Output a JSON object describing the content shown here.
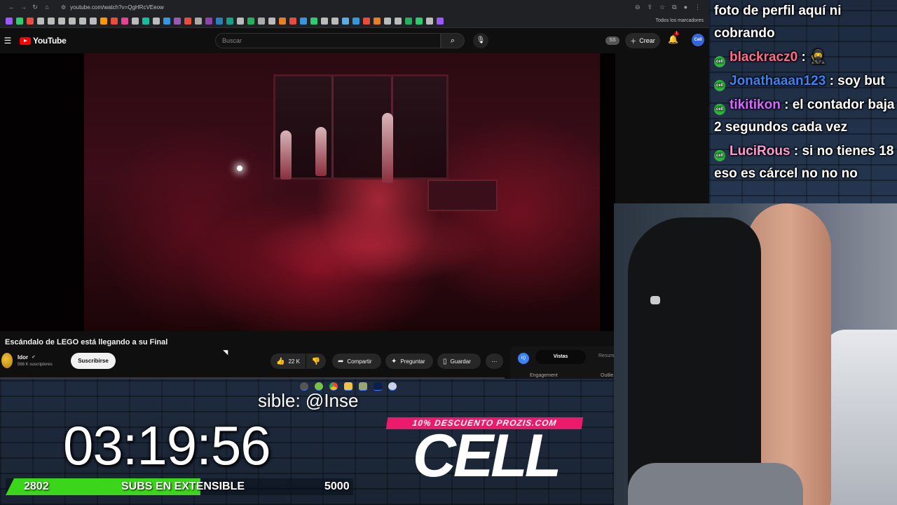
{
  "browser": {
    "url": "youtube.com/watch?v=QgHRcVEeow",
    "bookmarks_folder": "Todos los marcadores",
    "bookmark_colors": [
      "#9b59ff",
      "#2ecc71",
      "#e74c3c",
      "#bbbbbb",
      "#bbbbbb",
      "#bbbbbb",
      "#bbbbbb",
      "#bbbbbb",
      "#bbbbbb",
      "#ff9900",
      "#e74c3c",
      "#e84393",
      "#bbbbbb",
      "#1abc9c",
      "#bbbbbb",
      "#3498db",
      "#9b59b6",
      "#e74c3c",
      "#aaaaaa",
      "#8e44ad",
      "#2980b9",
      "#16a085",
      "#bbbbbb",
      "#27ae60",
      "#aaaaaa",
      "#bbbbbb",
      "#e67e22",
      "#e74c3c",
      "#3498db",
      "#2ecc71",
      "#bbbbbb",
      "#bbbbbb",
      "#5dade2",
      "#3498db",
      "#e74c3c",
      "#e67e22",
      "#bbbbbb",
      "#bbbbbb",
      "#27ae60",
      "#2ecc71",
      "#bbbbbb",
      "#9b59ff"
    ]
  },
  "youtube": {
    "logo_text": "YouTube",
    "search_placeholder": "Buscar",
    "ss_badge": "SS",
    "create_label": "Crear",
    "notification_count": "1",
    "avatar_text": "Cell"
  },
  "video": {
    "title": "Escándalo de LEGO está llegando a su Final",
    "channel": "Idor",
    "subscribers": "568 K suscriptores",
    "subscribe_label": "Suscribirse",
    "likes": "22 K",
    "share_label": "Compartir",
    "ask_label": "Preguntar",
    "save_label": "Guardar"
  },
  "side_panel": {
    "logo": "IQ",
    "tab_active": "Vistas",
    "tab_other": "Resum",
    "label_engagement": "Engagement",
    "label_outlier": "Outlie"
  },
  "chat": {
    "header_lines": "foto de perfil aquí ni cobrando",
    "messages": [
      {
        "user": "blackracz0",
        "text": " : 🥷",
        "color": "#ff6b8a"
      },
      {
        "user": "Jonathaaan123",
        "text": " : soy but",
        "color": "#3b82f6"
      },
      {
        "user": "tikitikon",
        "text": " : el contador baja 2 segundos cada vez",
        "color": "#d36bff"
      },
      {
        "user": "LuciRous",
        "text": " : si no tienes 18 eso es cárcel no no no",
        "color": "#ff9ad1"
      }
    ]
  },
  "overlay": {
    "subtitle": "sible: @Inse",
    "timer": "03:19:56",
    "progress_current": "2802",
    "progress_label": "SUBS EN EXTENSIBLE",
    "progress_goal": "5000",
    "progress_fraction": 0.5604,
    "promo_banner": "10% DESCUENTO PROZIS.COM",
    "brand": "CELL"
  }
}
